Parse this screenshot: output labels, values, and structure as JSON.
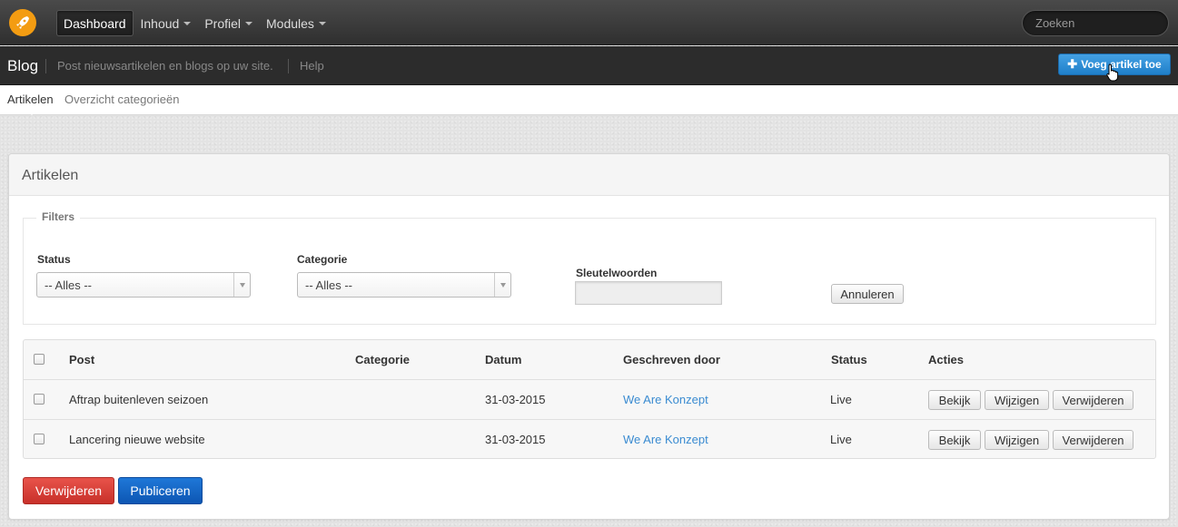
{
  "navbar": {
    "logo_icon": "rocket-icon",
    "items": [
      {
        "label": "Dashboard",
        "active": true,
        "dropdown": false
      },
      {
        "label": "Inhoud",
        "active": false,
        "dropdown": true
      },
      {
        "label": "Profiel",
        "active": false,
        "dropdown": true
      },
      {
        "label": "Modules",
        "active": false,
        "dropdown": true
      }
    ],
    "search_placeholder": "Zoeken"
  },
  "subheader": {
    "title": "Blog",
    "description": "Post nieuwsartikelen en blogs op uw site.",
    "help": "Help",
    "add_button": "Voeg artikel toe"
  },
  "tabs": {
    "active": "Artikelen",
    "other": "Overzicht categorieën"
  },
  "panel": {
    "title": "Artikelen",
    "filters": {
      "legend": "Filters",
      "status_label": "Status",
      "status_value": "-- Alles --",
      "category_label": "Categorie",
      "category_value": "-- Alles --",
      "keywords_label": "Sleutelwoorden",
      "keywords_value": "",
      "cancel_button": "Annuleren"
    },
    "table": {
      "headers": {
        "post": "Post",
        "category": "Categorie",
        "date": "Datum",
        "author": "Geschreven door",
        "status": "Status",
        "actions": "Acties"
      },
      "rows": [
        {
          "post": "Aftrap buitenleven seizoen",
          "category": "",
          "date": "31-03-2015",
          "author": "We Are Konzept",
          "status": "Live"
        },
        {
          "post": "Lancering nieuwe website",
          "category": "",
          "date": "31-03-2015",
          "author": "We Are Konzept",
          "status": "Live"
        }
      ],
      "actions": {
        "view": "Bekijk",
        "edit": "Wijzigen",
        "delete": "Verwijderen"
      }
    },
    "bulk": {
      "delete_button": "Verwijderen",
      "publish_button": "Publiceren"
    }
  },
  "colors": {
    "accent_blue": "#1f7fc9",
    "danger": "#c8302a",
    "logo_orange": "#f39c12"
  }
}
